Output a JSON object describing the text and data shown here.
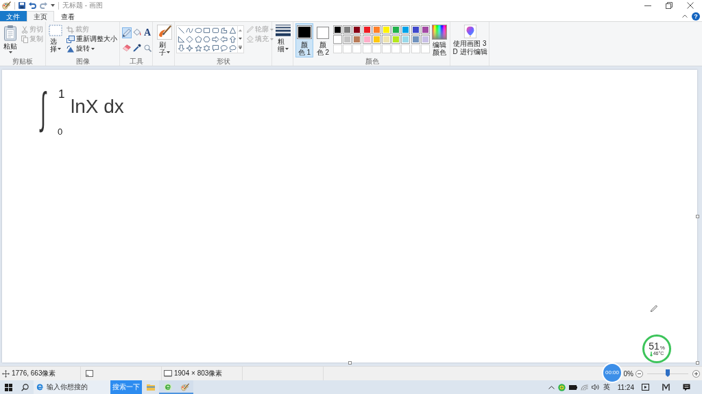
{
  "window": {
    "title": "无标题 - 画图",
    "help": "?"
  },
  "tabs": [
    {
      "label": "文件",
      "kind": "file",
      "selected": false
    },
    {
      "label": "主页",
      "kind": "tab",
      "selected": true
    },
    {
      "label": "查看",
      "kind": "tab",
      "selected": false
    }
  ],
  "clipboard": {
    "label": "剪贴板",
    "paste": "粘贴",
    "actions": [
      {
        "kind": "cut",
        "label": "剪切",
        "disabled": true
      },
      {
        "kind": "copy",
        "label": "复制",
        "disabled": true
      }
    ]
  },
  "image": {
    "label": "图像",
    "select": "选择",
    "actions": [
      {
        "kind": "crop",
        "label": "裁剪",
        "disabled": true
      },
      {
        "kind": "resize",
        "label": "重新调整大小",
        "disabled": false
      },
      {
        "kind": "rotate",
        "label": "旋转",
        "disabled": false
      }
    ]
  },
  "tools": {
    "label": "工具",
    "items": [
      {
        "kind": "pencil",
        "selected": true
      },
      {
        "kind": "fill",
        "selected": false
      },
      {
        "kind": "text",
        "glyph": "A",
        "selected": false
      },
      {
        "kind": "eraser",
        "selected": false
      },
      {
        "kind": "picker",
        "selected": false
      },
      {
        "kind": "magnifier",
        "selected": false
      }
    ]
  },
  "brushes": {
    "label": "刷子"
  },
  "shapes": {
    "label": "形状",
    "options": [
      {
        "kind": "outline",
        "label": "轮廓",
        "disabled": true
      },
      {
        "kind": "fill",
        "label": "填充",
        "disabled": true
      }
    ]
  },
  "size": {
    "label": "粗细"
  },
  "colors": {
    "label": "颜色",
    "slots": [
      {
        "label": "颜色 1",
        "color": "#000000",
        "selected": true
      },
      {
        "label": "颜色 2",
        "color": "#ffffff",
        "selected": false
      }
    ],
    "palette": [
      {
        "kind": "swatch",
        "color": "#000000"
      },
      {
        "kind": "swatch",
        "color": "#7f7f7f"
      },
      {
        "kind": "swatch",
        "color": "#880015"
      },
      {
        "kind": "swatch",
        "color": "#ed1c24"
      },
      {
        "kind": "swatch",
        "color": "#ff7f27"
      },
      {
        "kind": "swatch",
        "color": "#fff200"
      },
      {
        "kind": "swatch",
        "color": "#22b14c"
      },
      {
        "kind": "swatch",
        "color": "#00a2e8"
      },
      {
        "kind": "swatch",
        "color": "#3f48cc"
      },
      {
        "kind": "swatch",
        "color": "#a349a4"
      },
      {
        "kind": "swatch",
        "color": "#ffffff"
      },
      {
        "kind": "swatch",
        "color": "#c3c3c3"
      },
      {
        "kind": "swatch",
        "color": "#b97a57"
      },
      {
        "kind": "swatch",
        "color": "#ffaec9"
      },
      {
        "kind": "swatch",
        "color": "#ffc90e"
      },
      {
        "kind": "swatch",
        "color": "#efe4b0"
      },
      {
        "kind": "swatch",
        "color": "#b5e61d"
      },
      {
        "kind": "swatch",
        "color": "#99d9ea"
      },
      {
        "kind": "swatch",
        "color": "#7092be"
      },
      {
        "kind": "swatch",
        "color": "#c8bfe7"
      },
      {
        "kind": "empty"
      },
      {
        "kind": "empty"
      },
      {
        "kind": "empty"
      },
      {
        "kind": "empty"
      },
      {
        "kind": "empty"
      },
      {
        "kind": "empty"
      },
      {
        "kind": "empty"
      },
      {
        "kind": "empty"
      },
      {
        "kind": "empty"
      },
      {
        "kind": "empty"
      }
    ],
    "edit": "编辑颜色"
  },
  "paint3d": {
    "label": "使用画图 3D 进行编辑"
  },
  "canvas": {
    "integral": "∫",
    "upper_limit": "1",
    "lower_limit": "0",
    "integrand": "lnX dx"
  },
  "status_bar": {
    "cursor_position": "1776, 663像素",
    "canvas_size": "1904 × 803像素",
    "zoom": "0%",
    "zoom_slider": {
      "level": 0.5
    }
  },
  "overlays": {
    "timer": "00:00",
    "memory": {
      "value": "51",
      "unit": "%",
      "temperature": "46°C"
    }
  },
  "taskbar": {
    "search_placeholder": "输入你想搜的",
    "search_button": "搜索一下",
    "apps": [
      {
        "kind": "folder",
        "running": false
      },
      {
        "kind": "browser",
        "running": true
      },
      {
        "kind": "paint",
        "running": true
      }
    ],
    "language": "英",
    "time": "11:24"
  }
}
